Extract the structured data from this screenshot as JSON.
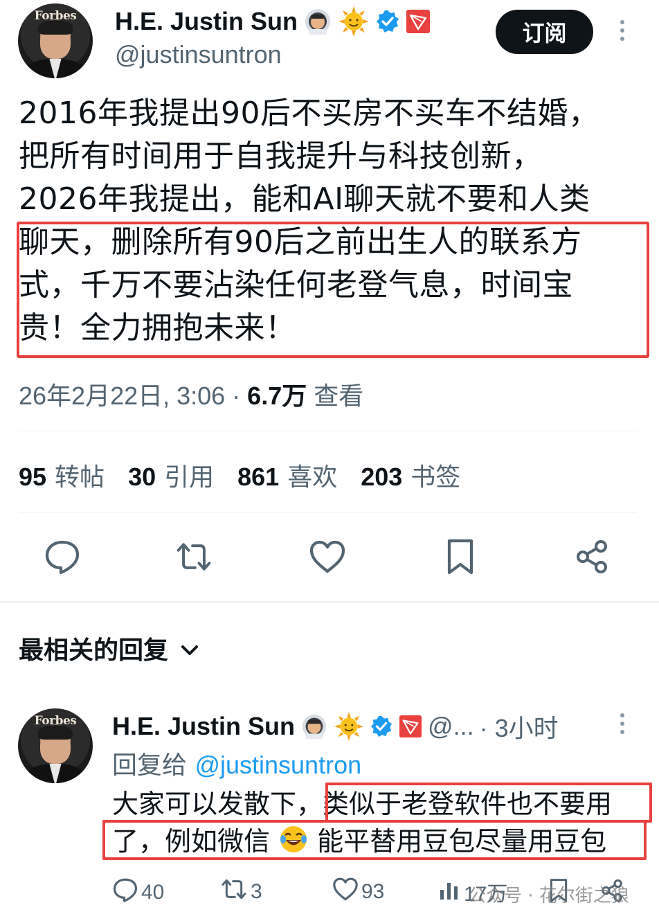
{
  "tweet": {
    "author": {
      "display_name": "H.E. Justin Sun",
      "handle": "@justinsuntron",
      "avatar_text": "Forbes"
    },
    "subscribe_label": "订阅",
    "text_lines": [
      "2016年我提出90后不买房不买车不结婚，",
      "把所有时间用于自我提升与科技创新，",
      "2026年我提出，能和AI聊天就不要和人类",
      "聊天，删除所有90后之前出生人的联系方",
      "式，千万不要沾染任何老登气息，时间宝",
      "贵！全力拥抱未来！"
    ],
    "timestamp": "26年2月22日, 3:06 · ",
    "views_count": "6.7万",
    "views_label": " 查看",
    "stats": {
      "retweets_count": "95",
      "retweets_label": "转帖",
      "quotes_count": "30",
      "quotes_label": "引用",
      "likes_count": "861",
      "likes_label": "喜欢",
      "bookmarks_count": "203",
      "bookmarks_label": "书签"
    }
  },
  "replies_section": {
    "label": "最相关的回复"
  },
  "reply": {
    "author": {
      "display_name": "H.E. Justin Sun",
      "handle_truncated": "@...",
      "time": "· 3小时",
      "avatar_text": "Forbes"
    },
    "reply_to_label": "回复给 ",
    "reply_to_handle": "@justinsuntron",
    "text_line_1a": "大家可以发散下，",
    "text_line_1b": "类似于老登软件也不要用",
    "text_line_2a": "了，例如微信 ",
    "text_line_2b": " 能平替用豆包尽量用豆包",
    "actions": {
      "replies": "40",
      "retweets": "3",
      "likes": "93",
      "views": "17万"
    }
  },
  "watermark": "公众号 · 花尔街之狼",
  "colors": {
    "text": "#0f1419",
    "secondary": "#536471",
    "accent_blue": "#1d9bf0",
    "highlight_red": "#e8413f",
    "tron_red": "#e8413f"
  }
}
